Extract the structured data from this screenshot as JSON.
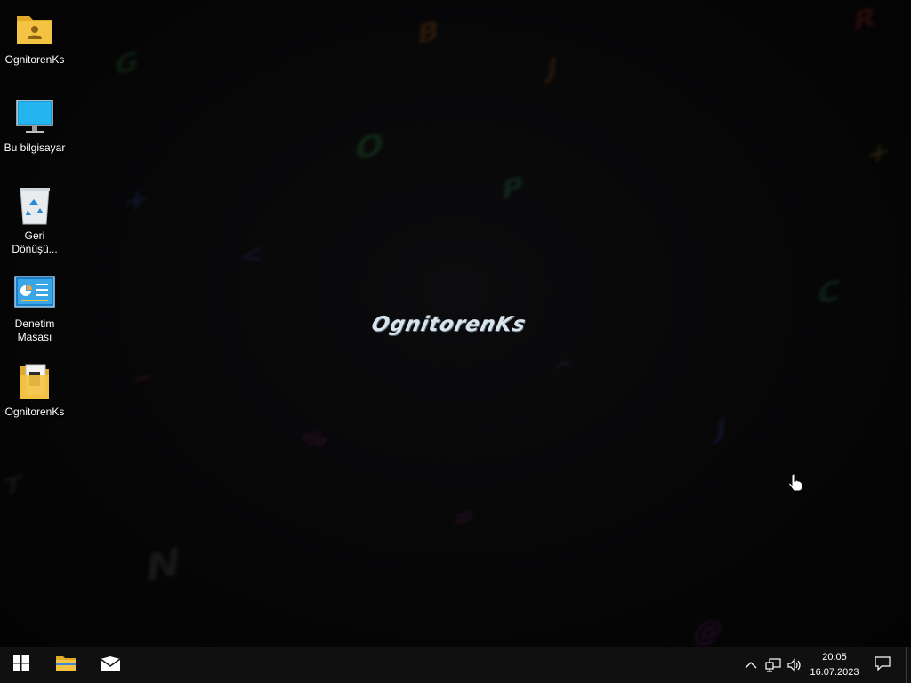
{
  "wallpaper": {
    "watermark_text": "OgnitorenKs"
  },
  "desktop_icons": [
    {
      "label": "OgnitorenKs",
      "icon": "user-folder-icon"
    },
    {
      "label": "Bu bilgisayar",
      "icon": "monitor-icon"
    },
    {
      "label": "Geri Dönüşü...",
      "icon": "recycle-bin-icon"
    },
    {
      "label": "Denetim Masası",
      "icon": "control-panel-icon"
    },
    {
      "label": "OgnitorenKs",
      "icon": "folder-document-icon"
    }
  ],
  "taskbar": {
    "pinned": [
      {
        "name": "start-button",
        "icon": "windows-logo-icon"
      },
      {
        "name": "file-explorer",
        "icon": "folder-icon"
      },
      {
        "name": "mail",
        "icon": "mail-icon"
      }
    ],
    "tray": {
      "icons": [
        "chevron-up-icon",
        "network-icon",
        "volume-icon"
      ],
      "time": "20:05",
      "date": "16.07.2023"
    }
  },
  "colors": {
    "background": "#050506",
    "taskbar": "#101010",
    "folder_yellow": "#f5c343",
    "windows_blue": "#ffffff"
  }
}
